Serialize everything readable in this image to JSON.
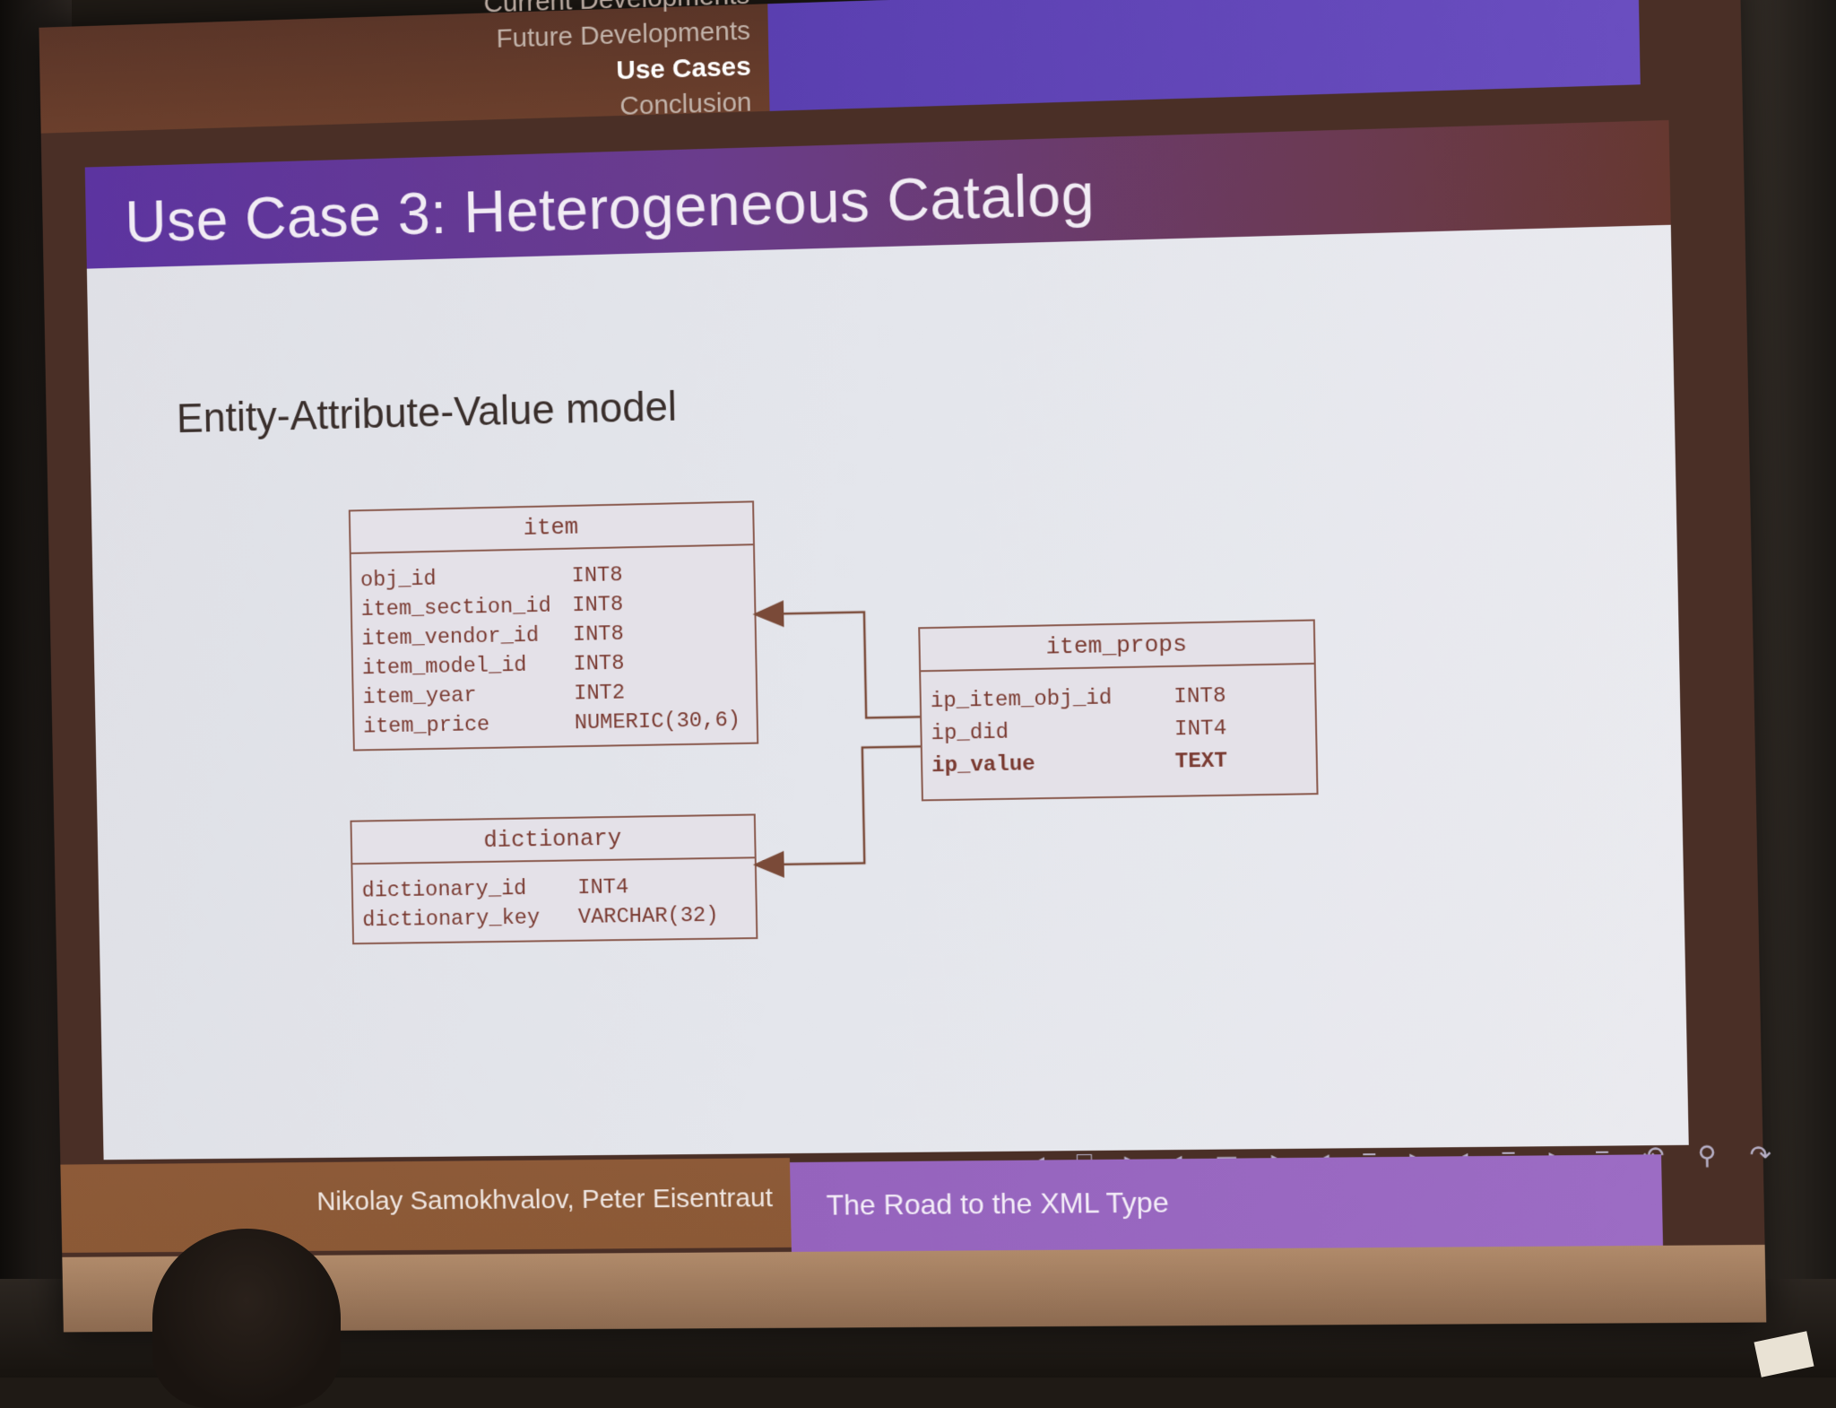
{
  "nav": {
    "cut_item": "Current Developments",
    "items": [
      "Future Developments",
      "Use Cases",
      "Conclusion"
    ],
    "current": "Use Cases"
  },
  "slide": {
    "title": "Use Case 3: Heterogeneous Catalog",
    "subtitle": "Entity-Attribute-Value model"
  },
  "tables": {
    "item": {
      "name": "item",
      "columns": [
        {
          "name": "obj_id",
          "type": "INT8"
        },
        {
          "name": "item_section_id",
          "type": "INT8"
        },
        {
          "name": "item_vendor_id",
          "type": "INT8"
        },
        {
          "name": "item_model_id",
          "type": "INT8"
        },
        {
          "name": "item_year",
          "type": "INT2"
        },
        {
          "name": "item_price",
          "type": "NUMERIC(30,6)"
        }
      ]
    },
    "dictionary": {
      "name": "dictionary",
      "columns": [
        {
          "name": "dictionary_id",
          "type": "INT4"
        },
        {
          "name": "dictionary_key",
          "type": "VARCHAR(32)"
        }
      ]
    },
    "item_props": {
      "name": "item_props",
      "columns": [
        {
          "name": "ip_item_obj_id",
          "type": "INT8"
        },
        {
          "name": "ip_did",
          "type": "INT4"
        },
        {
          "name": "ip_value",
          "type": "TEXT"
        }
      ]
    }
  },
  "footer": {
    "authors": "Nikolay Samokhvalov, Peter Eisentraut",
    "talk_title": "The Road to the XML Type"
  },
  "colors": {
    "accent_purple": "#5a3fb0",
    "frame_brown": "#6b3f2c",
    "table_text": "#7a3b32"
  }
}
